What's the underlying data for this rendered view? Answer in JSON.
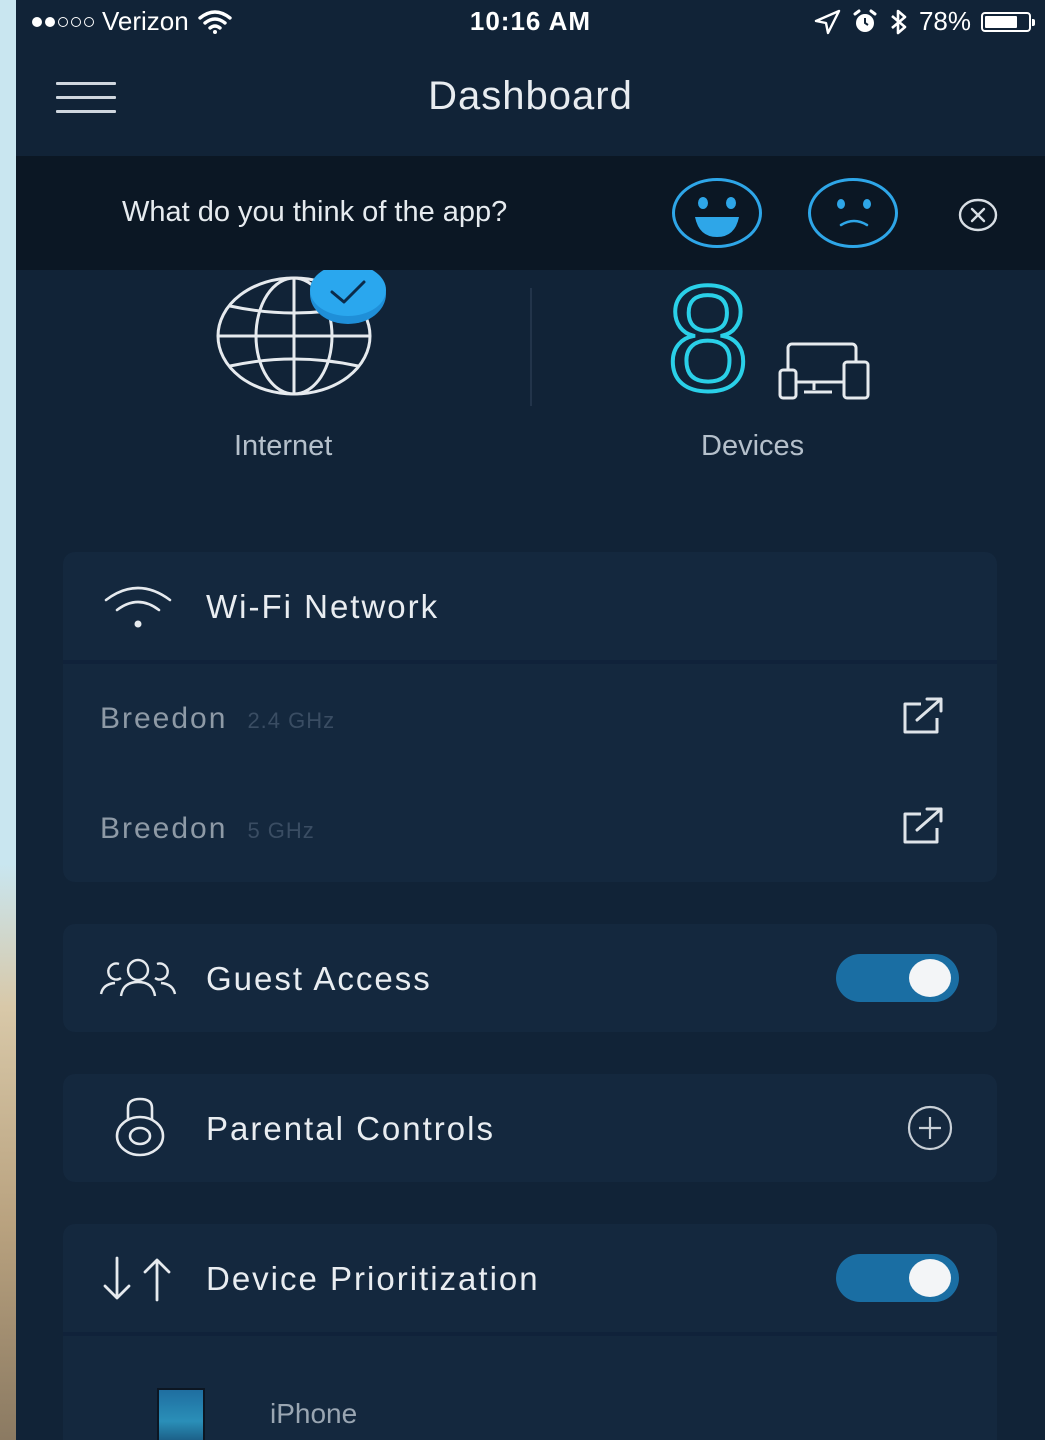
{
  "status_bar": {
    "carrier": "Verizon",
    "time": "10:16 AM",
    "battery": "78%",
    "battery_level": 0.78,
    "signal_bars_filled": 2,
    "signal_bars_total": 5
  },
  "header": {
    "title": "Dashboard"
  },
  "feedback": {
    "question": "What do you think of the app?"
  },
  "summary": {
    "internet_label": "Internet",
    "device_count": "8",
    "devices_label": "Devices"
  },
  "wifi": {
    "title": "Wi-Fi Network",
    "networks": [
      {
        "name": "Breedon",
        "band": "2.4 GHz"
      },
      {
        "name": "Breedon",
        "band": "5 GHz"
      }
    ]
  },
  "guest_access": {
    "title": "Guest Access",
    "enabled": true
  },
  "parental_controls": {
    "title": "Parental Controls"
  },
  "device_prioritization": {
    "title": "Device Prioritization",
    "enabled": true,
    "devices": [
      {
        "name": "iPhone"
      }
    ]
  },
  "colors": {
    "background": "#112337",
    "card": "#14283e",
    "accent": "#2ea6e8",
    "toggle_on": "#1a6ea3",
    "device_count": "#2ad0e8"
  },
  "icons": [
    "menu-icon",
    "happy-face-icon",
    "sad-face-icon",
    "close-icon",
    "globe-icon",
    "checkmark-icon",
    "devices-icon",
    "wifi-icon",
    "external-link-icon",
    "guests-icon",
    "lock-icon",
    "plus-icon",
    "priority-arrows-icon"
  ]
}
